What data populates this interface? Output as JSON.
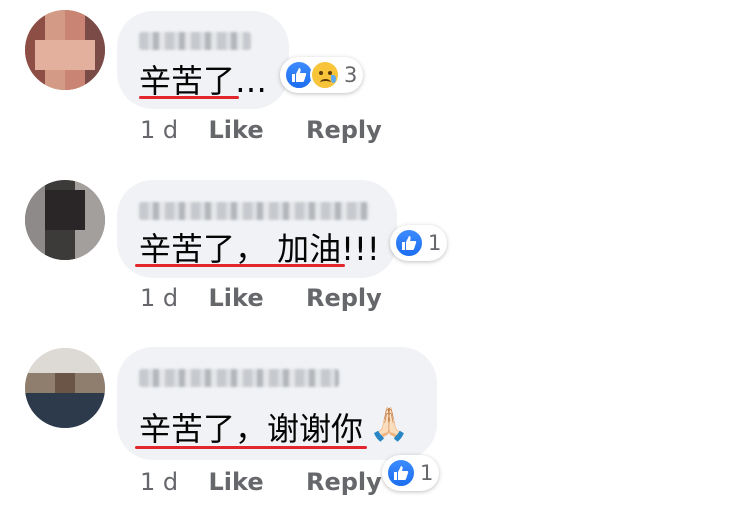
{
  "comments": [
    {
      "text": "辛苦了…",
      "reaction_count": "3",
      "time": "1 d",
      "like": "Like",
      "reply": "Reply"
    },
    {
      "text": "辛苦了， 加油!!!",
      "reaction_count": "1",
      "time": "1 d",
      "like": "Like",
      "reply": "Reply"
    },
    {
      "text": "辛苦了，谢谢你",
      "reaction_count": "1",
      "time": "1 d",
      "like": "Like",
      "reply": "Reply",
      "emoji": "🙏🏻"
    }
  ],
  "colors": {
    "bubble": "#f0f2f5",
    "like_blue": "#1d6ef0",
    "underline": "#e3262e",
    "meta": "#65676b"
  },
  "icons": [
    "like-icon",
    "sad-icon",
    "praying-hands-emoji"
  ]
}
